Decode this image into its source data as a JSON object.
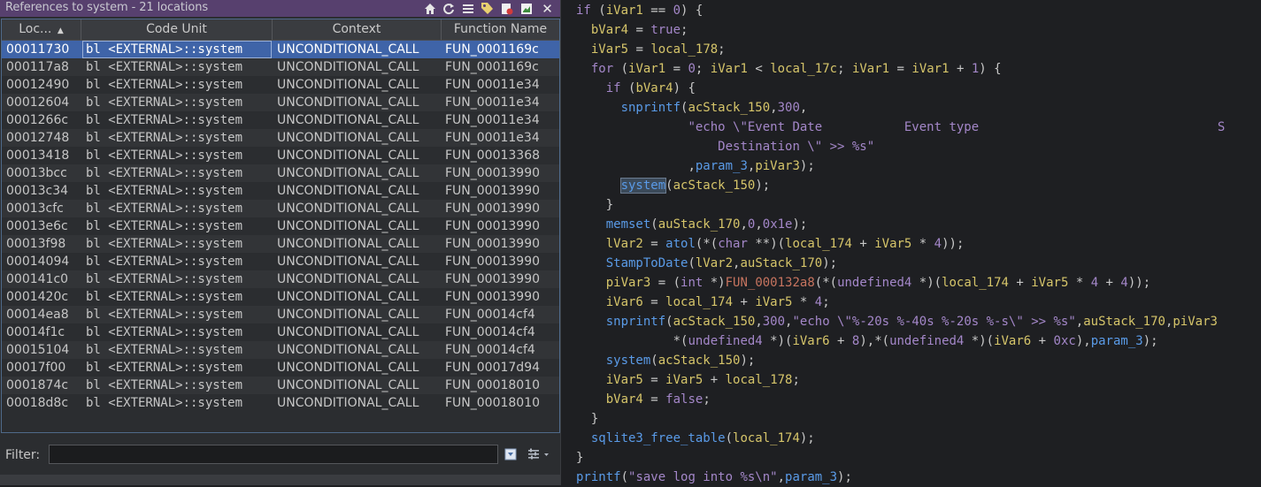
{
  "window": {
    "title": "References to system - 21 locations",
    "toolbar_icons": [
      "home-icon",
      "refresh-icon",
      "columns-icon",
      "tag-icon",
      "delete-icon",
      "snapshot-icon",
      "close-icon"
    ]
  },
  "table": {
    "columns": [
      "Loc...",
      "Code Unit",
      "Context",
      "Function Name"
    ],
    "rows": [
      {
        "loc": "00011730",
        "code": "bl <EXTERNAL>::system",
        "ctx": "UNCONDITIONAL_CALL",
        "fn": "FUN_0001169c"
      },
      {
        "loc": "000117a8",
        "code": "bl <EXTERNAL>::system",
        "ctx": "UNCONDITIONAL_CALL",
        "fn": "FUN_0001169c"
      },
      {
        "loc": "00012490",
        "code": "bl <EXTERNAL>::system",
        "ctx": "UNCONDITIONAL_CALL",
        "fn": "FUN_00011e34"
      },
      {
        "loc": "00012604",
        "code": "bl <EXTERNAL>::system",
        "ctx": "UNCONDITIONAL_CALL",
        "fn": "FUN_00011e34"
      },
      {
        "loc": "0001266c",
        "code": "bl <EXTERNAL>::system",
        "ctx": "UNCONDITIONAL_CALL",
        "fn": "FUN_00011e34"
      },
      {
        "loc": "00012748",
        "code": "bl <EXTERNAL>::system",
        "ctx": "UNCONDITIONAL_CALL",
        "fn": "FUN_00011e34"
      },
      {
        "loc": "00013418",
        "code": "bl <EXTERNAL>::system",
        "ctx": "UNCONDITIONAL_CALL",
        "fn": "FUN_00013368"
      },
      {
        "loc": "00013bcc",
        "code": "bl <EXTERNAL>::system",
        "ctx": "UNCONDITIONAL_CALL",
        "fn": "FUN_00013990"
      },
      {
        "loc": "00013c34",
        "code": "bl <EXTERNAL>::system",
        "ctx": "UNCONDITIONAL_CALL",
        "fn": "FUN_00013990"
      },
      {
        "loc": "00013cfc",
        "code": "bl <EXTERNAL>::system",
        "ctx": "UNCONDITIONAL_CALL",
        "fn": "FUN_00013990"
      },
      {
        "loc": "00013e6c",
        "code": "bl <EXTERNAL>::system",
        "ctx": "UNCONDITIONAL_CALL",
        "fn": "FUN_00013990"
      },
      {
        "loc": "00013f98",
        "code": "bl <EXTERNAL>::system",
        "ctx": "UNCONDITIONAL_CALL",
        "fn": "FUN_00013990"
      },
      {
        "loc": "00014094",
        "code": "bl <EXTERNAL>::system",
        "ctx": "UNCONDITIONAL_CALL",
        "fn": "FUN_00013990"
      },
      {
        "loc": "000141c0",
        "code": "bl <EXTERNAL>::system",
        "ctx": "UNCONDITIONAL_CALL",
        "fn": "FUN_00013990"
      },
      {
        "loc": "0001420c",
        "code": "bl <EXTERNAL>::system",
        "ctx": "UNCONDITIONAL_CALL",
        "fn": "FUN_00013990"
      },
      {
        "loc": "00014ea8",
        "code": "bl <EXTERNAL>::system",
        "ctx": "UNCONDITIONAL_CALL",
        "fn": "FUN_00014cf4"
      },
      {
        "loc": "00014f1c",
        "code": "bl <EXTERNAL>::system",
        "ctx": "UNCONDITIONAL_CALL",
        "fn": "FUN_00014cf4"
      },
      {
        "loc": "00015104",
        "code": "bl <EXTERNAL>::system",
        "ctx": "UNCONDITIONAL_CALL",
        "fn": "FUN_00014cf4"
      },
      {
        "loc": "00017f00",
        "code": "bl <EXTERNAL>::system",
        "ctx": "UNCONDITIONAL_CALL",
        "fn": "FUN_00017d94"
      },
      {
        "loc": "0001874c",
        "code": "bl <EXTERNAL>::system",
        "ctx": "UNCONDITIONAL_CALL",
        "fn": "FUN_00018010"
      },
      {
        "loc": "00018d8c",
        "code": "bl <EXTERNAL>::system",
        "ctx": "UNCONDITIONAL_CALL",
        "fn": "FUN_00018010"
      }
    ],
    "selected_index": 0
  },
  "filter": {
    "label": "Filter:",
    "value": "",
    "icons": [
      "filter-options-icon",
      "settings-icon"
    ]
  },
  "decompiler": {
    "lines": [
      [
        [
          "if",
          "kw"
        ],
        [
          " (",
          ""
        ],
        [
          "iVar1",
          "var"
        ],
        [
          " == ",
          ""
        ],
        [
          "0",
          "num"
        ],
        [
          ") {",
          ""
        ]
      ],
      [
        [
          "  ",
          ""
        ],
        [
          "bVar4",
          "var"
        ],
        [
          " = ",
          ""
        ],
        [
          "true",
          "kw"
        ],
        [
          ";",
          ""
        ]
      ],
      [
        [
          "  ",
          ""
        ],
        [
          "iVar5",
          "var"
        ],
        [
          " = ",
          ""
        ],
        [
          "local_178",
          "var"
        ],
        [
          ";",
          ""
        ]
      ],
      [
        [
          "  ",
          ""
        ],
        [
          "for",
          "kw"
        ],
        [
          " (",
          ""
        ],
        [
          "iVar1",
          "var"
        ],
        [
          " = ",
          ""
        ],
        [
          "0",
          "num"
        ],
        [
          "; ",
          ""
        ],
        [
          "iVar1",
          "var"
        ],
        [
          " < ",
          ""
        ],
        [
          "local_17c",
          "var"
        ],
        [
          "; ",
          ""
        ],
        [
          "iVar1",
          "var"
        ],
        [
          " = ",
          ""
        ],
        [
          "iVar1",
          "var"
        ],
        [
          " + ",
          ""
        ],
        [
          "1",
          "num"
        ],
        [
          ") {",
          ""
        ]
      ],
      [
        [
          "    ",
          ""
        ],
        [
          "if",
          "kw"
        ],
        [
          " (",
          ""
        ],
        [
          "bVar4",
          "var"
        ],
        [
          ") {",
          ""
        ]
      ],
      [
        [
          "      ",
          ""
        ],
        [
          "snprintf",
          "fn"
        ],
        [
          "(",
          ""
        ],
        [
          "acStack_150",
          "var"
        ],
        [
          ",",
          ""
        ],
        [
          "300",
          "num"
        ],
        [
          ",",
          ""
        ]
      ],
      [
        [
          "               ",
          ""
        ],
        [
          "\"echo \\\"Event Date           Event type                                S",
          "str"
        ]
      ],
      [
        [
          "                   ",
          ""
        ],
        [
          "Destination \\\" >> %s\"",
          "str"
        ]
      ],
      [
        [
          "               ",
          ""
        ],
        [
          ",",
          ""
        ],
        [
          "param_3",
          "fn"
        ],
        [
          ",",
          ""
        ],
        [
          "piVar3",
          "var"
        ],
        [
          ");",
          ""
        ]
      ],
      [
        [
          "      ",
          ""
        ],
        [
          "system",
          "fn hl"
        ],
        [
          "(",
          ""
        ],
        [
          "acStack_150",
          "var"
        ],
        [
          ");",
          ""
        ]
      ],
      [
        [
          "    ",
          ""
        ],
        [
          "}",
          ""
        ]
      ],
      [
        [
          "    ",
          ""
        ],
        [
          "memset",
          "fn"
        ],
        [
          "(",
          ""
        ],
        [
          "auStack_170",
          "var"
        ],
        [
          ",",
          ""
        ],
        [
          "0",
          "num"
        ],
        [
          ",",
          ""
        ],
        [
          "0x1e",
          "num"
        ],
        [
          ");",
          ""
        ]
      ],
      [
        [
          "    ",
          ""
        ],
        [
          "lVar2",
          "var"
        ],
        [
          " = ",
          ""
        ],
        [
          "atol",
          "fn"
        ],
        [
          "(*(",
          ""
        ],
        [
          "char",
          "typ"
        ],
        [
          " **)(",
          ""
        ],
        [
          "local_174",
          "var"
        ],
        [
          " + ",
          ""
        ],
        [
          "iVar5",
          "var"
        ],
        [
          " * ",
          ""
        ],
        [
          "4",
          "num"
        ],
        [
          "));",
          ""
        ]
      ],
      [
        [
          "    ",
          ""
        ],
        [
          "StampToDate",
          "fn"
        ],
        [
          "(",
          ""
        ],
        [
          "lVar2",
          "var"
        ],
        [
          ",",
          ""
        ],
        [
          "auStack_170",
          "var"
        ],
        [
          ");",
          ""
        ]
      ],
      [
        [
          "    ",
          ""
        ],
        [
          "piVar3",
          "var"
        ],
        [
          " = (",
          ""
        ],
        [
          "int",
          "typ"
        ],
        [
          " *)",
          ""
        ],
        [
          "FUN_000132a8",
          "red"
        ],
        [
          "(*(",
          ""
        ],
        [
          "undefined4",
          "typ"
        ],
        [
          " *)(",
          ""
        ],
        [
          "local_174",
          "var"
        ],
        [
          " + ",
          ""
        ],
        [
          "iVar5",
          "var"
        ],
        [
          " * ",
          ""
        ],
        [
          "4",
          "num"
        ],
        [
          " + ",
          ""
        ],
        [
          "4",
          "num"
        ],
        [
          "));",
          ""
        ]
      ],
      [
        [
          "    ",
          ""
        ],
        [
          "iVar6",
          "var"
        ],
        [
          " = ",
          ""
        ],
        [
          "local_174",
          "var"
        ],
        [
          " + ",
          ""
        ],
        [
          "iVar5",
          "var"
        ],
        [
          " * ",
          ""
        ],
        [
          "4",
          "num"
        ],
        [
          ";",
          ""
        ]
      ],
      [
        [
          "    ",
          ""
        ],
        [
          "snprintf",
          "fn"
        ],
        [
          "(",
          ""
        ],
        [
          "acStack_150",
          "var"
        ],
        [
          ",",
          ""
        ],
        [
          "300",
          "num"
        ],
        [
          ",",
          ""
        ],
        [
          "\"echo \\\"%-20s %-40s %-20s %-s\\\" >> %s\"",
          "str"
        ],
        [
          ",",
          ""
        ],
        [
          "auStack_170",
          "var"
        ],
        [
          ",",
          ""
        ],
        [
          "piVar3",
          "var"
        ]
      ],
      [
        [
          "             *(",
          ""
        ],
        [
          "undefined4",
          "typ"
        ],
        [
          " *)(",
          ""
        ],
        [
          "iVar6",
          "var"
        ],
        [
          " + ",
          ""
        ],
        [
          "8",
          "num"
        ],
        [
          "),*(",
          ""
        ],
        [
          "undefined4",
          "typ"
        ],
        [
          " *)(",
          ""
        ],
        [
          "iVar6",
          "var"
        ],
        [
          " + ",
          ""
        ],
        [
          "0xc",
          "num"
        ],
        [
          "),",
          ""
        ],
        [
          "param_3",
          "fn"
        ],
        [
          ");",
          ""
        ]
      ],
      [
        [
          "    ",
          ""
        ],
        [
          "system",
          "fn"
        ],
        [
          "(",
          ""
        ],
        [
          "acStack_150",
          "var"
        ],
        [
          ");",
          ""
        ]
      ],
      [
        [
          "    ",
          ""
        ],
        [
          "iVar5",
          "var"
        ],
        [
          " = ",
          ""
        ],
        [
          "iVar5",
          "var"
        ],
        [
          " + ",
          ""
        ],
        [
          "local_178",
          "var"
        ],
        [
          ";",
          ""
        ]
      ],
      [
        [
          "    ",
          ""
        ],
        [
          "bVar4",
          "var"
        ],
        [
          " = ",
          ""
        ],
        [
          "false",
          "kw"
        ],
        [
          ";",
          ""
        ]
      ],
      [
        [
          "  ",
          ""
        ],
        [
          "}",
          ""
        ]
      ],
      [
        [
          "  ",
          ""
        ],
        [
          "sqlite3_free_table",
          "fn"
        ],
        [
          "(",
          ""
        ],
        [
          "local_174",
          "var"
        ],
        [
          ");",
          ""
        ]
      ],
      [
        [
          "}",
          ""
        ]
      ],
      [
        [
          "printf",
          "fn"
        ],
        [
          "(",
          ""
        ],
        [
          "\"save log into %s\\n\"",
          "str"
        ],
        [
          ",",
          ""
        ],
        [
          "param_3",
          "fn"
        ],
        [
          ");",
          ""
        ]
      ]
    ]
  }
}
